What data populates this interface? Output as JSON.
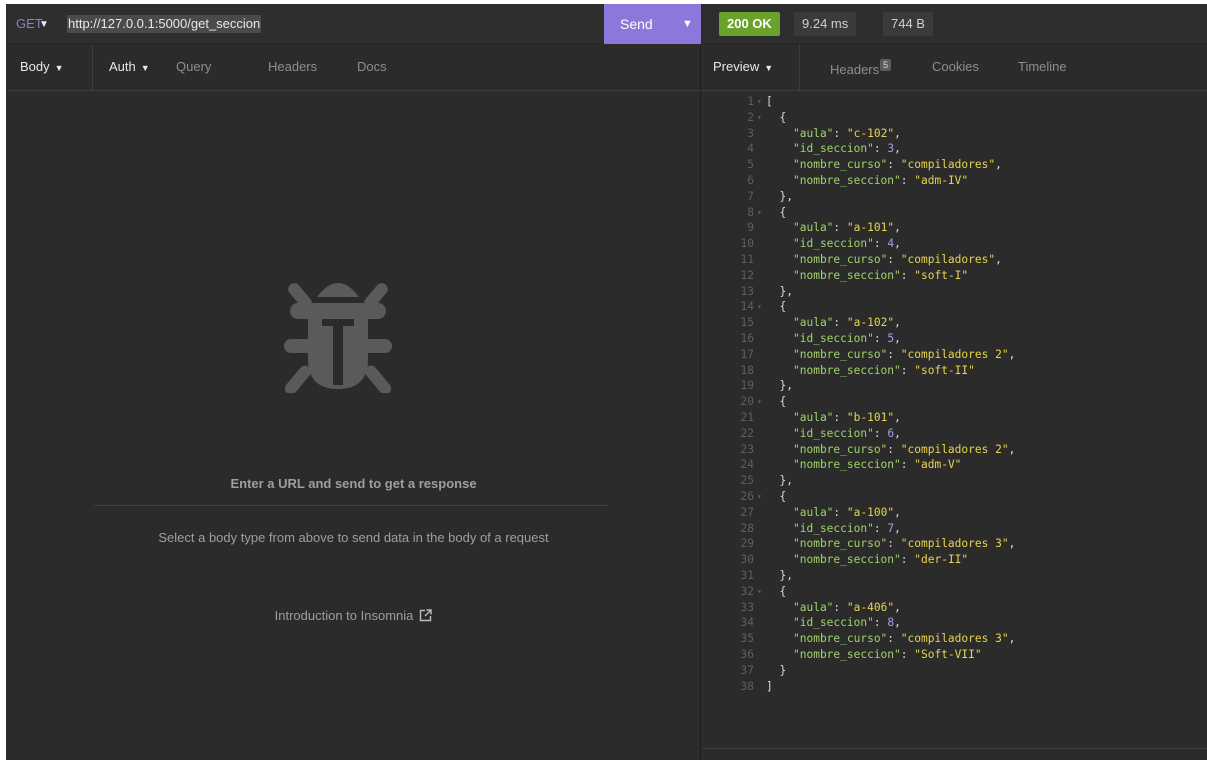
{
  "request": {
    "method": "GET",
    "url": "http://127.0.0.1:5000/get_seccion",
    "send_label": "Send",
    "tabs": [
      {
        "label": "Body"
      },
      {
        "label": "Auth"
      },
      {
        "label": "Query"
      },
      {
        "label": "Headers"
      },
      {
        "label": "Docs"
      }
    ],
    "empty_state": {
      "title": "Enter a URL and send to get a response",
      "hint": "Select a body type from above to send data in the body of a request",
      "link": "Introduction to Insomnia"
    }
  },
  "response": {
    "status": "200 OK",
    "time": "9.24 ms",
    "size": "744 B",
    "tabs": [
      {
        "label": "Preview"
      },
      {
        "label": "Headers",
        "badge": "5"
      },
      {
        "label": "Cookies"
      },
      {
        "label": "Timeline"
      }
    ],
    "records": [
      {
        "aula": "c-102",
        "id_seccion": 3,
        "nombre_curso": "compiladores",
        "nombre_seccion": "adm-IV"
      },
      {
        "aula": "a-101",
        "id_seccion": 4,
        "nombre_curso": "compiladores",
        "nombre_seccion": "soft-I"
      },
      {
        "aula": "a-102",
        "id_seccion": 5,
        "nombre_curso": "compiladores 2",
        "nombre_seccion": "soft-II"
      },
      {
        "aula": "b-101",
        "id_seccion": 6,
        "nombre_curso": "compiladores 2",
        "nombre_seccion": "adm-V"
      },
      {
        "aula": "a-100",
        "id_seccion": 7,
        "nombre_curso": "compiladores 3",
        "nombre_seccion": "der-II"
      },
      {
        "aula": "a-406",
        "id_seccion": 8,
        "nombre_curso": "compiladores 3",
        "nombre_seccion": "Soft-VII"
      }
    ]
  },
  "colors": {
    "accent": "#8b78da",
    "status_ok": "#6aa22c",
    "json_key": "#9fd46a",
    "json_string": "#e8d44e",
    "json_number": "#a59ae8"
  },
  "icons": [
    "caret-down-icon",
    "bug-icon",
    "external-link-icon"
  ]
}
